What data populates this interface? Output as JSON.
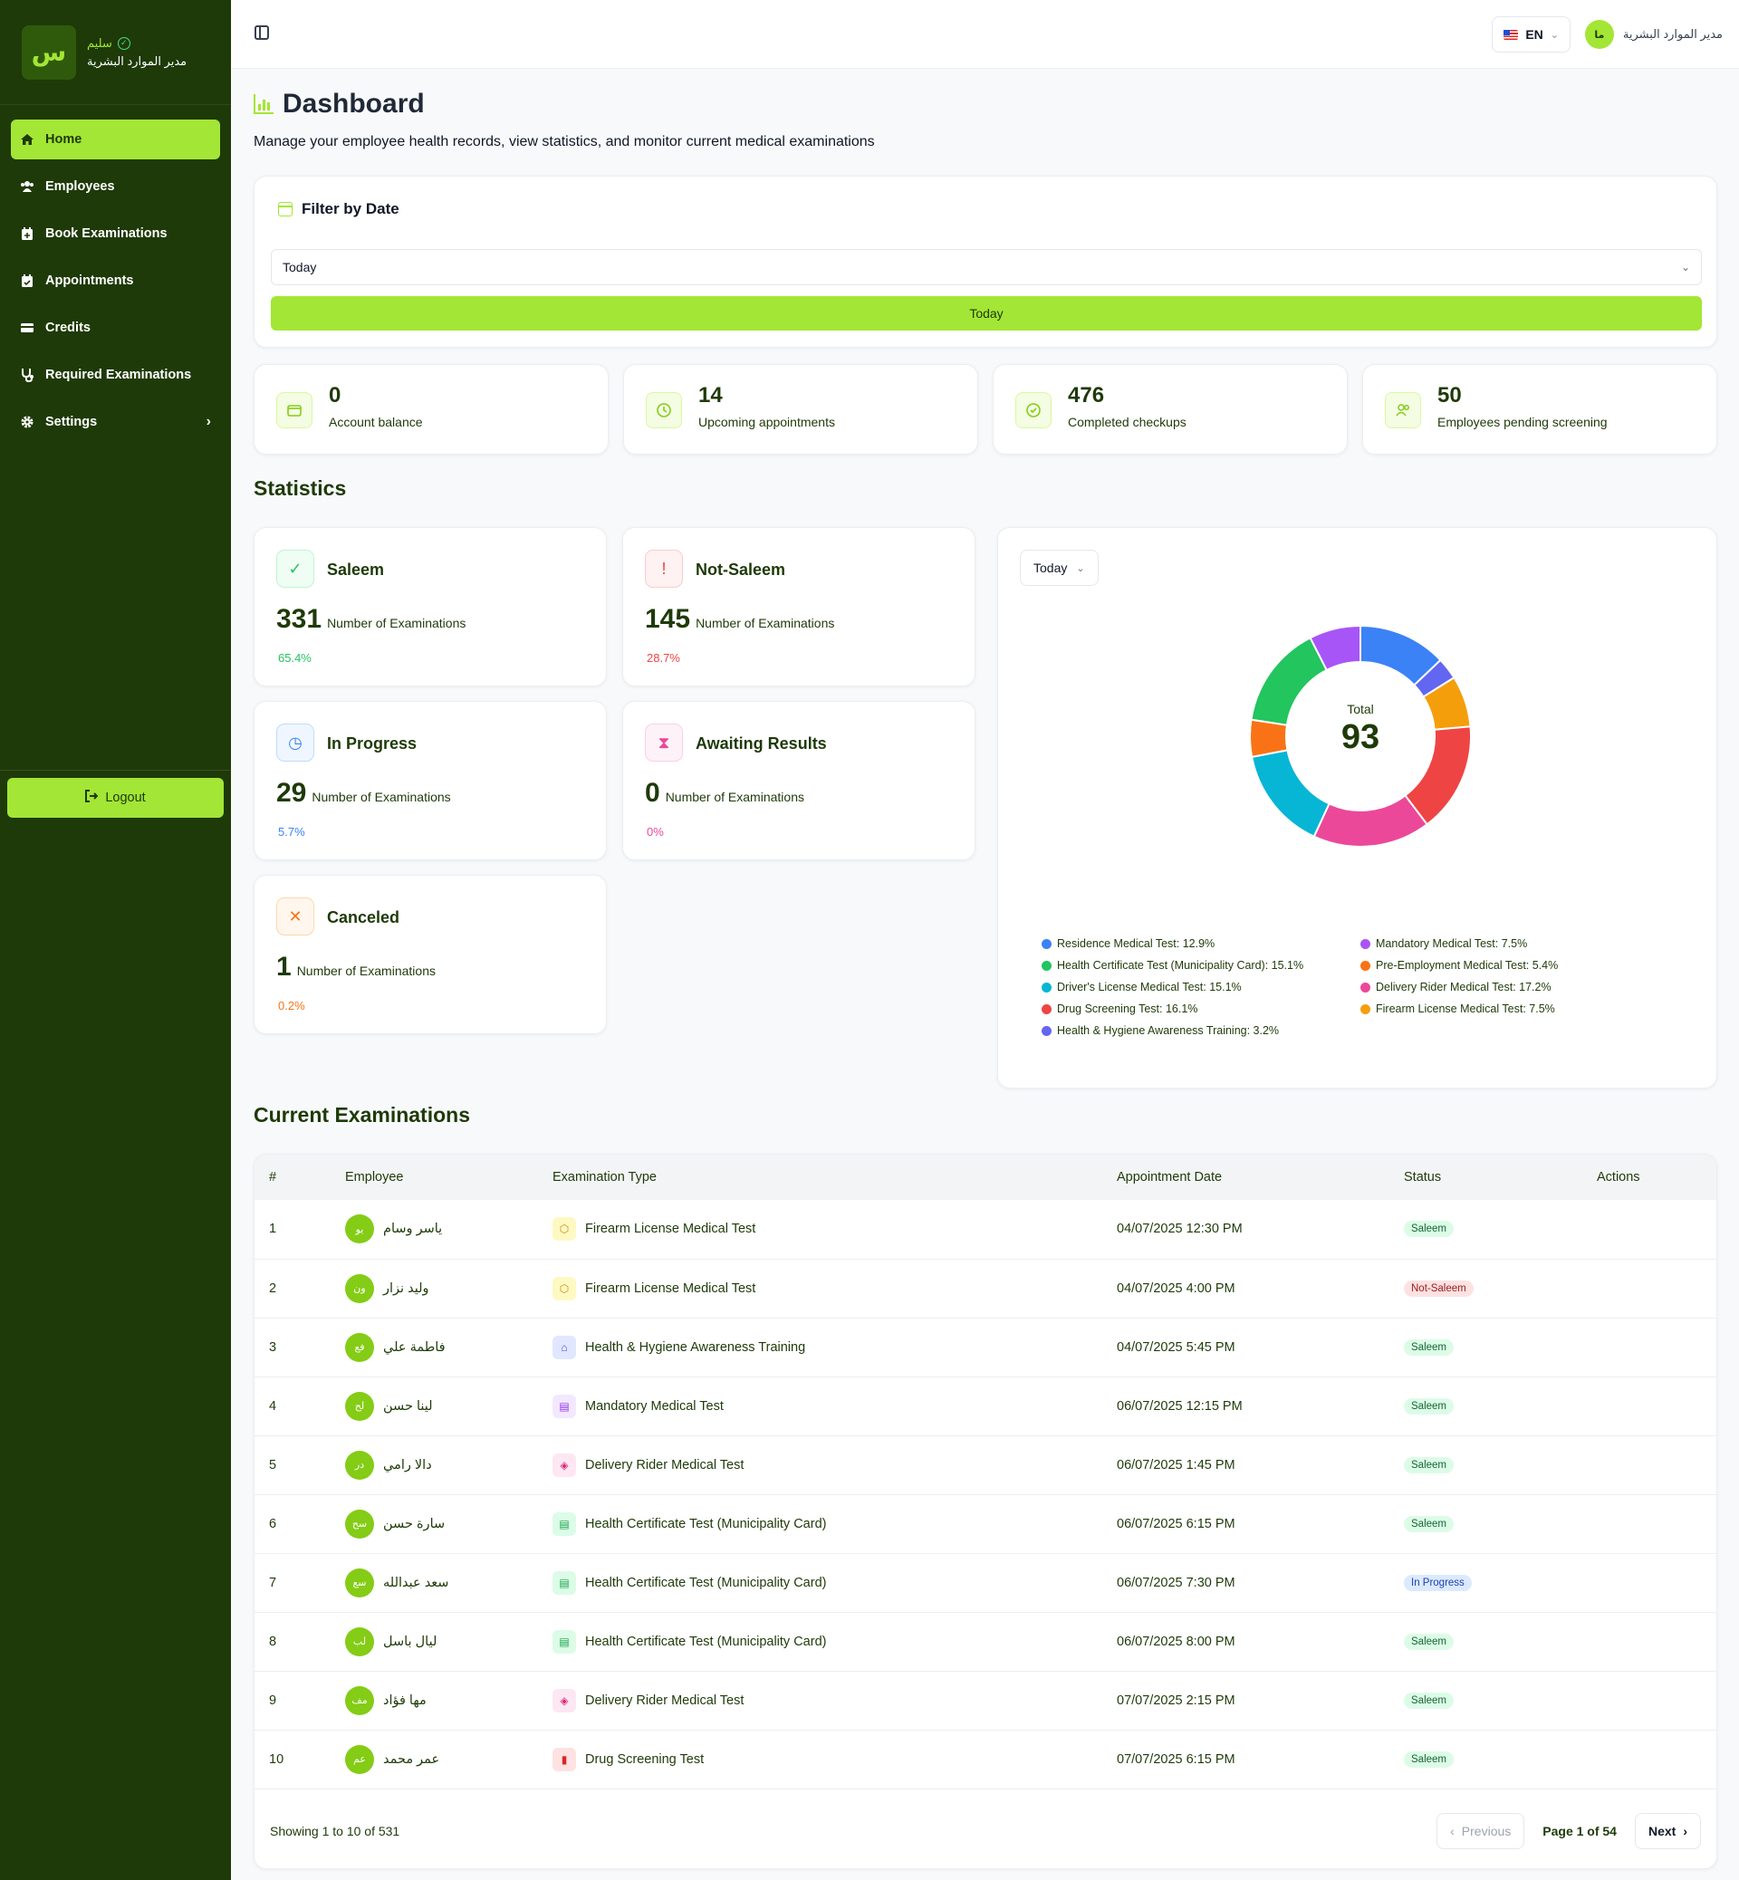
{
  "sidebar": {
    "logo_letter": "س",
    "user_name": "سليم",
    "user_role": "مدير الموارد البشرية",
    "items": [
      {
        "label": "Home",
        "icon": "home-icon",
        "active": true
      },
      {
        "label": "Employees",
        "icon": "users-icon"
      },
      {
        "label": "Book Examinations",
        "icon": "calendar-plus-icon"
      },
      {
        "label": "Appointments",
        "icon": "calendar-check-icon"
      },
      {
        "label": "Credits",
        "icon": "credit-card-icon"
      },
      {
        "label": "Required Examinations",
        "icon": "stethoscope-icon"
      },
      {
        "label": "Settings",
        "icon": "gear-icon"
      }
    ],
    "logout_label": "Logout"
  },
  "topbar": {
    "lang": "EN",
    "user_name": "مدير الموارد البشرية",
    "user_initials": "ما"
  },
  "page": {
    "title": "Dashboard",
    "subtitle": "Manage your employee health records, view statistics, and monitor current medical examinations"
  },
  "filter": {
    "title": "Filter by Date",
    "selected": "Today",
    "button": "Today"
  },
  "summary": [
    {
      "value": "0",
      "label": "Account balance",
      "icon": "wallet-icon"
    },
    {
      "value": "14",
      "label": "Upcoming appointments",
      "icon": "clock-icon"
    },
    {
      "value": "476",
      "label": "Completed checkups",
      "icon": "check-circle-icon"
    },
    {
      "value": "50",
      "label": "Employees pending screening",
      "icon": "users-icon"
    }
  ],
  "statistics": {
    "heading": "Statistics",
    "unit_label": "Number of Examinations",
    "cards": [
      {
        "title": "Saleem",
        "value": "331",
        "pct": "65.4%",
        "color": "#22c55e"
      },
      {
        "title": "Not-Saleem",
        "value": "145",
        "pct": "28.7%",
        "color": "#ef4444"
      },
      {
        "title": "In Progress",
        "value": "29",
        "pct": "5.7%",
        "color": "#3b82f6"
      },
      {
        "title": "Awaiting Results",
        "value": "0",
        "pct": "0%",
        "color": "#ec4899"
      },
      {
        "title": "Canceled",
        "value": "1",
        "pct": "0.2%",
        "color": "#f97316"
      }
    ]
  },
  "chart_data": {
    "type": "pie",
    "period": "Today",
    "center_label": "Total",
    "center_value": "93",
    "slices": [
      {
        "label": "Residence Medical Test",
        "pct": 12.9,
        "legend": "Residence Medical Test: 12.9%",
        "color": "#3b82f6"
      },
      {
        "label": "Health & Hygiene Awareness Training",
        "pct": 3.2,
        "legend": "Health & Hygiene Awareness Training: 3.2%",
        "color": "#6366f1"
      },
      {
        "label": "Firearm License Medical Test",
        "pct": 7.5,
        "legend": "Firearm License Medical Test: 7.5%",
        "color": "#f59e0b"
      },
      {
        "label": "Drug Screening Test",
        "pct": 16.1,
        "legend": "Drug Screening Test: 16.1%",
        "color": "#ef4444"
      },
      {
        "label": "Delivery Rider Medical Test",
        "pct": 17.2,
        "legend": "Delivery Rider Medical Test: 17.2%",
        "color": "#ec4899"
      },
      {
        "label": "Driver's License Medical Test",
        "pct": 15.1,
        "legend": "Driver's License Medical Test: 15.1%",
        "color": "#06b6d4"
      },
      {
        "label": "Pre-Employment Medical Test",
        "pct": 5.4,
        "legend": "Pre-Employment Medical Test: 5.4%",
        "color": "#f97316"
      },
      {
        "label": "Health Certificate Test (Municipality Card)",
        "pct": 15.1,
        "legend": "Health Certificate Test (Municipality Card): 15.1%",
        "color": "#22c55e"
      },
      {
        "label": "Mandatory Medical Test",
        "pct": 7.5,
        "legend": "Mandatory Medical Test: 7.5%",
        "color": "#a855f7"
      }
    ],
    "legend_left": [
      0,
      7,
      5,
      3,
      1
    ],
    "legend_right": [
      8,
      6,
      4,
      2
    ]
  },
  "table": {
    "heading": "Current Examinations",
    "columns": [
      "#",
      "Employee",
      "Examination Type",
      "Appointment Date",
      "Status",
      "Actions"
    ],
    "rows": [
      {
        "n": "1",
        "initials": "يو",
        "name": "ياسر وسام",
        "exam": "Firearm License Medical Test",
        "ex_icon": "shield-icon",
        "date": "04/07/2025 12:30 PM",
        "status": "Saleem"
      },
      {
        "n": "2",
        "initials": "ون",
        "name": "وليد نزار",
        "exam": "Firearm License Medical Test",
        "ex_icon": "shield-icon",
        "date": "04/07/2025 4:00 PM",
        "status": "Not-Saleem"
      },
      {
        "n": "3",
        "initials": "فع",
        "name": "فاطمة علي",
        "exam": "Health & Hygiene Awareness Training",
        "ex_icon": "graduation-cap-icon",
        "date": "04/07/2025 5:45 PM",
        "status": "Saleem"
      },
      {
        "n": "4",
        "initials": "لح",
        "name": "لينا حسن",
        "exam": "Mandatory Medical Test",
        "ex_icon": "document-icon",
        "date": "06/07/2025 12:15 PM",
        "status": "Saleem"
      },
      {
        "n": "5",
        "initials": "در",
        "name": "دالا رامي",
        "exam": "Delivery Rider Medical Test",
        "ex_icon": "package-icon",
        "date": "06/07/2025 1:45 PM",
        "status": "Saleem"
      },
      {
        "n": "6",
        "initials": "سح",
        "name": "سارة حسن",
        "exam": "Health Certificate Test (Municipality Card)",
        "ex_icon": "certificate-icon",
        "date": "06/07/2025 6:15 PM",
        "status": "Saleem"
      },
      {
        "n": "7",
        "initials": "سع",
        "name": "سعد عبدالله",
        "exam": "Health Certificate Test (Municipality Card)",
        "ex_icon": "certificate-icon",
        "date": "06/07/2025 7:30 PM",
        "status": "In Progress"
      },
      {
        "n": "8",
        "initials": "لب",
        "name": "ليال باسل",
        "exam": "Health Certificate Test (Municipality Card)",
        "ex_icon": "certificate-icon",
        "date": "06/07/2025 8:00 PM",
        "status": "Saleem"
      },
      {
        "n": "9",
        "initials": "مف",
        "name": "مها فؤاد",
        "exam": "Delivery Rider Medical Test",
        "ex_icon": "package-icon",
        "date": "07/07/2025 2:15 PM",
        "status": "Saleem"
      },
      {
        "n": "10",
        "initials": "عم",
        "name": "عمر محمد",
        "exam": "Drug Screening Test",
        "ex_icon": "test-tube-icon",
        "date": "07/07/2025 6:15 PM",
        "status": "Saleem"
      }
    ],
    "showing": "Showing 1 to 10 of 531",
    "prev_label": "Previous",
    "next_label": "Next",
    "page_info": "Page 1 of 54"
  }
}
